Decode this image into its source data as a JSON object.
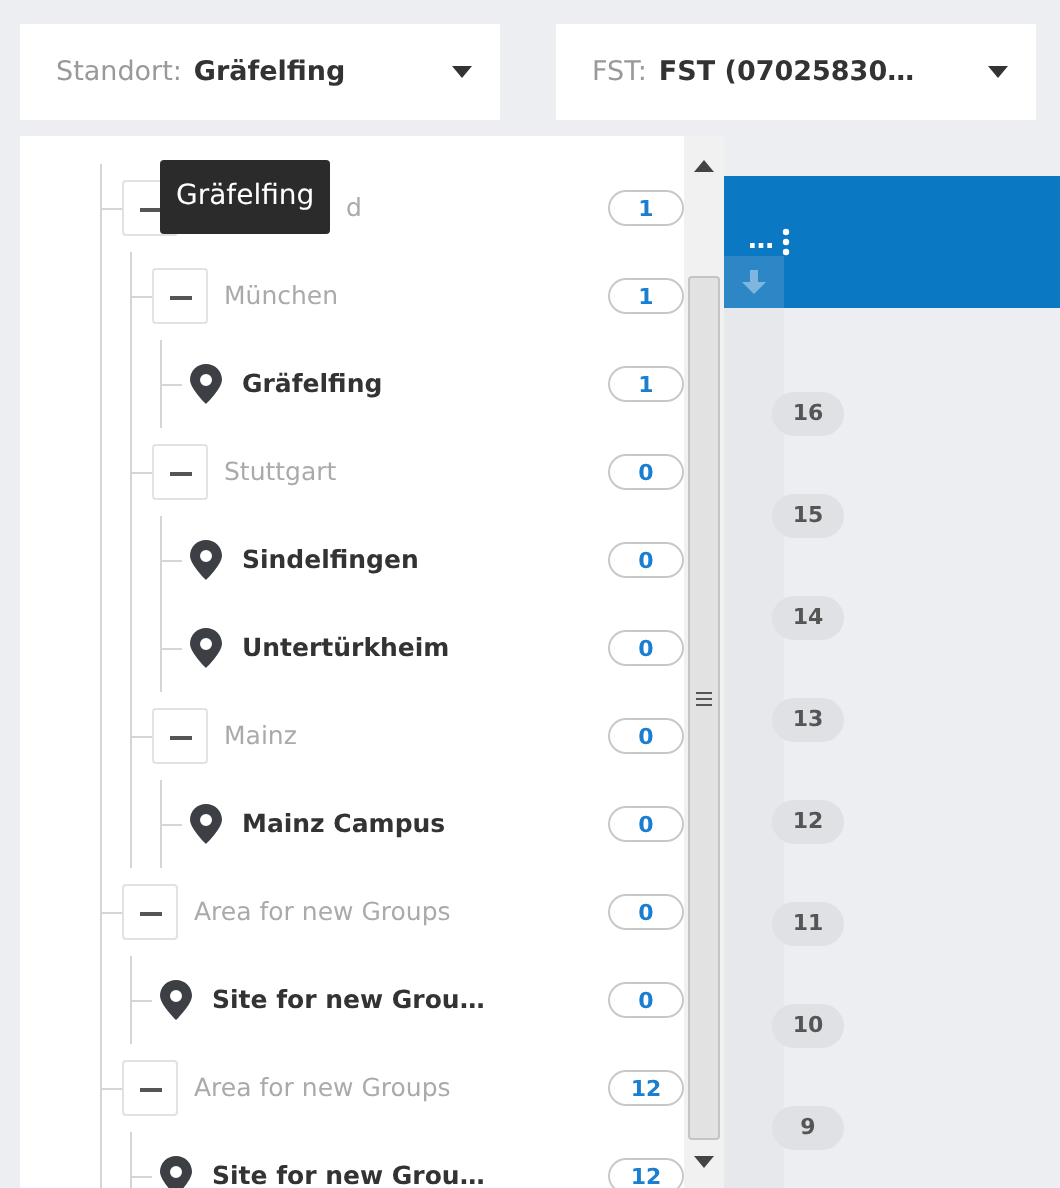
{
  "filters": [
    {
      "label": "Standort:",
      "value": "Gräfelfing"
    },
    {
      "label": "FST:",
      "value": "FST (07025830…"
    }
  ],
  "tooltip": "Gräfelfing",
  "tree": [
    {
      "kind": "group",
      "label": "d",
      "count": "1",
      "expanded": true,
      "children": [
        {
          "kind": "group",
          "label": "München",
          "count": "1",
          "expanded": true,
          "children": [
            {
              "kind": "site",
              "label": "Gräfelfing",
              "count": "1"
            }
          ]
        },
        {
          "kind": "group",
          "label": "Stuttgart",
          "count": "0",
          "expanded": true,
          "children": [
            {
              "kind": "site",
              "label": "Sindelfingen",
              "count": "0"
            },
            {
              "kind": "site",
              "label": "Untertürkheim",
              "count": "0"
            }
          ]
        },
        {
          "kind": "group",
          "label": "Mainz",
          "count": "0",
          "expanded": true,
          "children": [
            {
              "kind": "site",
              "label": "Mainz Campus",
              "count": "0"
            }
          ]
        }
      ]
    },
    {
      "kind": "group",
      "label": "Area for new Groups",
      "count": "0",
      "expanded": true,
      "children": [
        {
          "kind": "site",
          "label": "Site for new Grou…",
          "count": "0"
        }
      ]
    },
    {
      "kind": "group",
      "label": "Area for new Groups",
      "count": "12",
      "expanded": true,
      "children": [
        {
          "kind": "site",
          "label": "Site for new Grou…",
          "count": "12"
        }
      ]
    }
  ],
  "side_panel": {
    "header_text": "…",
    "badges": [
      "16",
      "15",
      "14",
      "13",
      "12",
      "11",
      "10",
      "9"
    ]
  }
}
